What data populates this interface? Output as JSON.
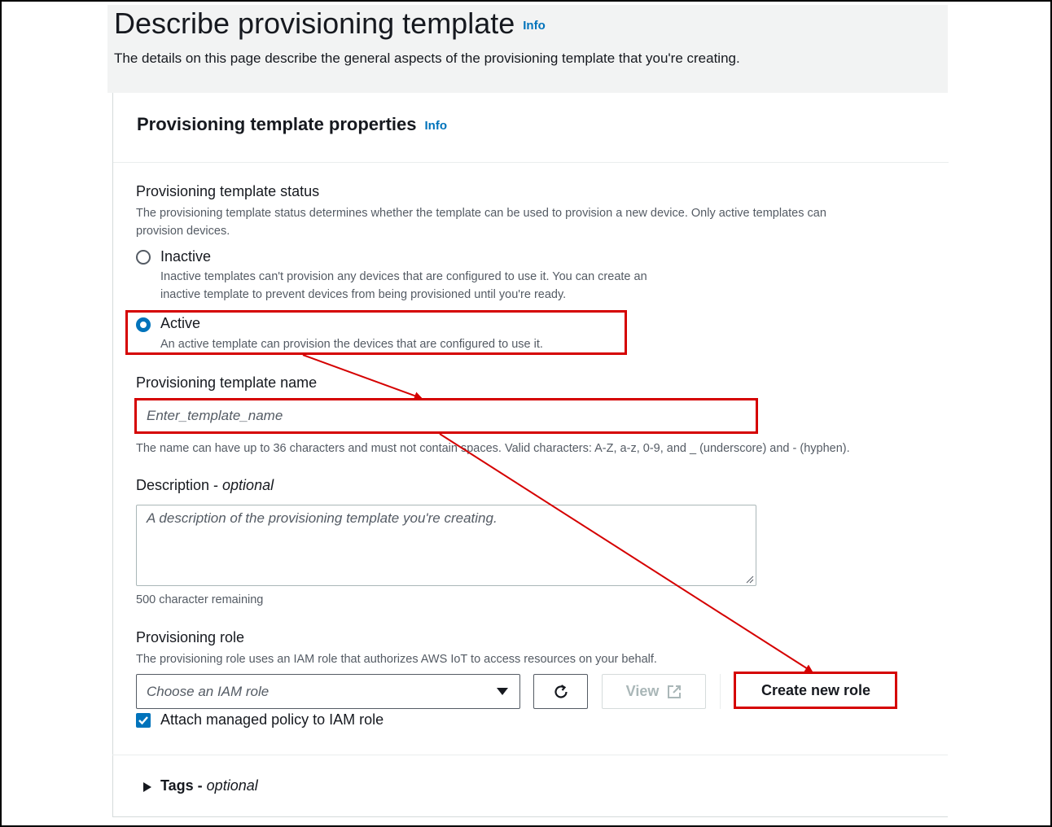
{
  "header": {
    "title": "Describe provisioning template",
    "info_label": "Info",
    "description": "The details on this page describe the general aspects of the provisioning template that you're creating."
  },
  "panel": {
    "title": "Provisioning template properties",
    "info_label": "Info"
  },
  "status": {
    "label": "Provisioning template status",
    "hint_line1": "The provisioning template status determines whether the template can be used to provision a new device. Only active templates can",
    "hint_line2": "provision devices.",
    "options": [
      {
        "label": "Inactive",
        "desc_line1": "Inactive templates can't provision any devices that are configured to use it. You can create an",
        "desc_line2": "inactive template to prevent devices from being provisioned until you're ready.",
        "selected": false
      },
      {
        "label": "Active",
        "desc_line1": "An active template can provision the devices that are configured to use it.",
        "selected": true
      }
    ]
  },
  "name_field": {
    "label": "Provisioning template name",
    "value": "Enter_template_name",
    "hint": "The name can have up to 36 characters and must not contain spaces. Valid characters: A-Z, a-z, 0-9, and _ (underscore) and - (hyphen)."
  },
  "description_field": {
    "label": "Description - ",
    "label_optional": "optional",
    "placeholder": "A description of the provisioning template you're creating.",
    "remaining": "500 character remaining"
  },
  "role": {
    "label": "Provisioning role",
    "hint": "The provisioning role uses an IAM role that authorizes AWS IoT to access resources on your behalf.",
    "select_placeholder": "Choose an IAM role",
    "view_label": "View",
    "create_label": "Create new role",
    "attach_policy_label": "Attach managed policy to IAM role",
    "attach_policy_checked": true
  },
  "tags": {
    "label": "Tags - ",
    "label_optional": "optional"
  },
  "colors": {
    "link": "#0073bb",
    "highlight": "#d50000",
    "header_bg": "#f2f3f3"
  }
}
